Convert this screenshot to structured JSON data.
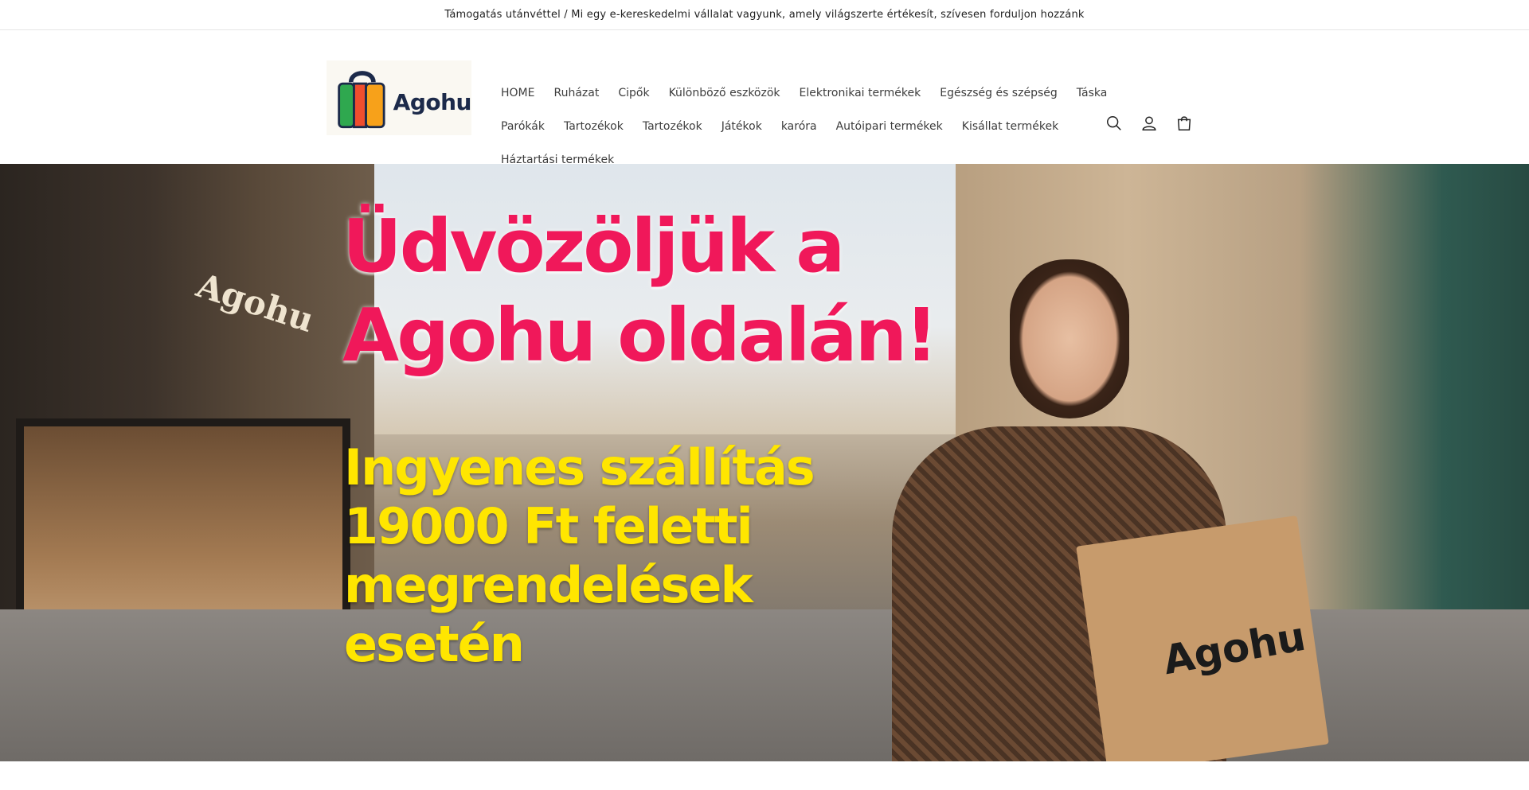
{
  "announcement": {
    "text": "Támogatás utánvéttel / Mi egy e-kereskedelmi vállalat vagyunk, amely világszerte értékesít, szívesen forduljon hozzánk"
  },
  "header": {
    "logo_text": "Agohu",
    "nav": [
      [
        "HOME",
        "Ruházat",
        "Cipők",
        "Különböző eszközök",
        "Elektronikai termékek",
        "Egészség és szépség",
        "Táska"
      ],
      [
        "Parókák",
        "Tartozékok",
        "Tartozékok",
        "Játékok",
        "karóra",
        "Autóipari termékek",
        "Kisállat termékek"
      ],
      [
        "Háztartási termékek"
      ]
    ],
    "icons": [
      "search-icon",
      "account-icon",
      "cart-icon"
    ]
  },
  "hero": {
    "title_line1": "Üdvözöljük a",
    "title_line2": "Agohu oldalán!",
    "sub_line1": "Ingyenes szállítás",
    "sub_line2": "19000 Ft feletti",
    "sub_line3": "megrendelések",
    "sub_line4": "esetén",
    "store_sign": "Agohu",
    "bag_text": "Agohu"
  },
  "colors": {
    "title": "#f0185a",
    "subtitle": "#ffe600",
    "logo_text": "#1c2a4a"
  }
}
